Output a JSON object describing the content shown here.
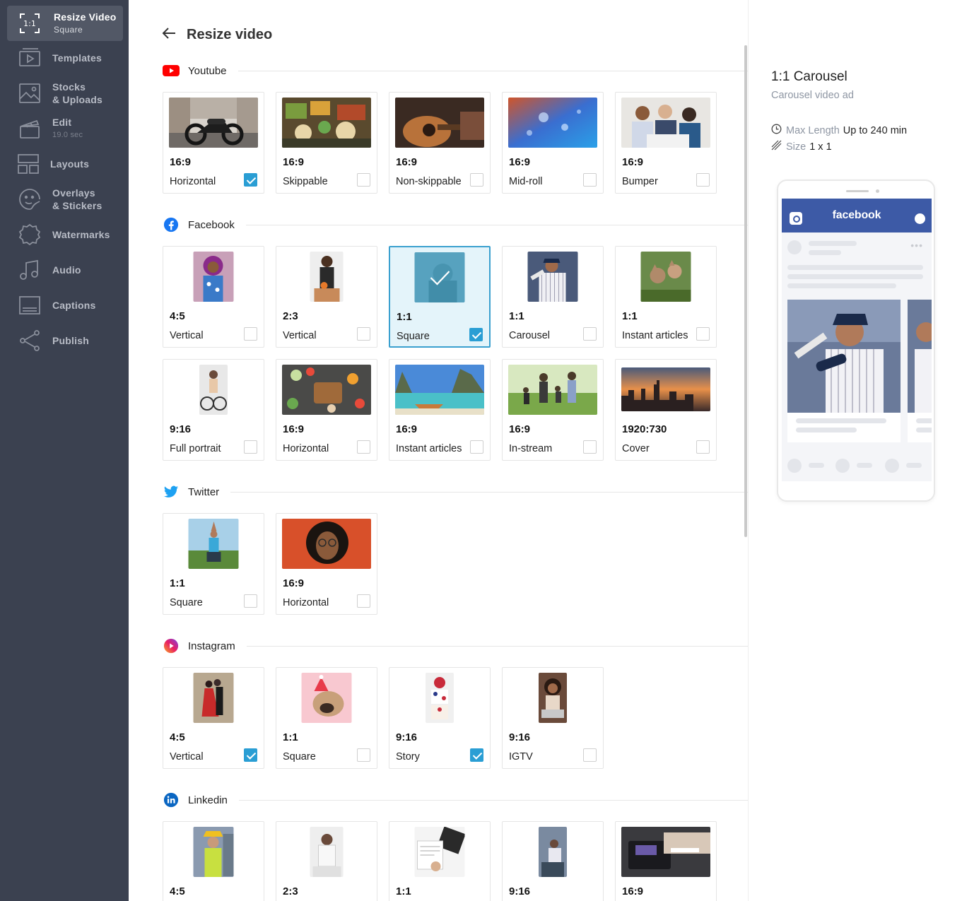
{
  "sidebar": {
    "active": {
      "icon_text": "1:1",
      "title": "Resize Video",
      "subtitle": "Square"
    },
    "items": [
      {
        "label": "Templates",
        "sub": ""
      },
      {
        "label": "Stocks",
        "sub": "& Uploads"
      },
      {
        "label": "Edit",
        "sub": "19.0 sec"
      },
      {
        "label": "Layouts",
        "sub": ""
      },
      {
        "label": "Overlays",
        "sub": "& Stickers"
      },
      {
        "label": "Watermarks",
        "sub": ""
      },
      {
        "label": "Audio",
        "sub": ""
      },
      {
        "label": "Captions",
        "sub": ""
      },
      {
        "label": "Publish",
        "sub": ""
      }
    ]
  },
  "header": {
    "title": "Resize video"
  },
  "sections": [
    {
      "name": "Youtube",
      "cards": [
        {
          "ratio": "16:9",
          "label": "Horizontal",
          "checked": true
        },
        {
          "ratio": "16:9",
          "label": "Skippable",
          "checked": false
        },
        {
          "ratio": "16:9",
          "label": "Non-skippable",
          "checked": false
        },
        {
          "ratio": "16:9",
          "label": "Mid-roll",
          "checked": false
        },
        {
          "ratio": "16:9",
          "label": "Bumper",
          "checked": false
        }
      ]
    },
    {
      "name": "Facebook",
      "cards": [
        {
          "ratio": "4:5",
          "label": "Vertical",
          "checked": false
        },
        {
          "ratio": "2:3",
          "label": "Vertical",
          "checked": false
        },
        {
          "ratio": "1:1",
          "label": "Square",
          "checked": true,
          "selected": true
        },
        {
          "ratio": "1:1",
          "label": "Carousel",
          "checked": false
        },
        {
          "ratio": "1:1",
          "label": "Instant articles",
          "checked": false
        },
        {
          "ratio": "9:16",
          "label": "Full portrait",
          "checked": false
        },
        {
          "ratio": "16:9",
          "label": "Horizontal",
          "checked": false
        },
        {
          "ratio": "16:9",
          "label": "Instant articles",
          "checked": false
        },
        {
          "ratio": "16:9",
          "label": "In-stream",
          "checked": false
        },
        {
          "ratio": "1920:730",
          "label": "Cover",
          "checked": false
        }
      ]
    },
    {
      "name": "Twitter",
      "cards": [
        {
          "ratio": "1:1",
          "label": "Square",
          "checked": false
        },
        {
          "ratio": "16:9",
          "label": "Horizontal",
          "checked": false
        }
      ]
    },
    {
      "name": "Instagram",
      "cards": [
        {
          "ratio": "4:5",
          "label": "Vertical",
          "checked": true
        },
        {
          "ratio": "1:1",
          "label": "Square",
          "checked": false
        },
        {
          "ratio": "9:16",
          "label": "Story",
          "checked": true
        },
        {
          "ratio": "9:16",
          "label": "IGTV",
          "checked": false
        }
      ]
    },
    {
      "name": "Linkedin",
      "cards": [
        {
          "ratio": "4:5",
          "label": "",
          "checked": false
        },
        {
          "ratio": "2:3",
          "label": "",
          "checked": false
        },
        {
          "ratio": "1:1",
          "label": "",
          "checked": false
        },
        {
          "ratio": "9:16",
          "label": "",
          "checked": false
        },
        {
          "ratio": "16:9",
          "label": "",
          "checked": false
        }
      ]
    }
  ],
  "preview": {
    "title": "1:1 Carousel",
    "subtitle": "Carousel video ad",
    "max_length_label": "Max Length",
    "max_length_value": "Up to 240 min",
    "size_label": "Size",
    "size_value": "1 x 1",
    "phone_brand": "facebook"
  },
  "colors": {
    "sidebar_bg": "#3b4150",
    "accent": "#2a9ed4",
    "facebook_blue": "#3d5aa6",
    "youtube_red": "#ff0000",
    "twitter_blue": "#1da1f2",
    "linkedin_blue": "#0a66c2"
  }
}
